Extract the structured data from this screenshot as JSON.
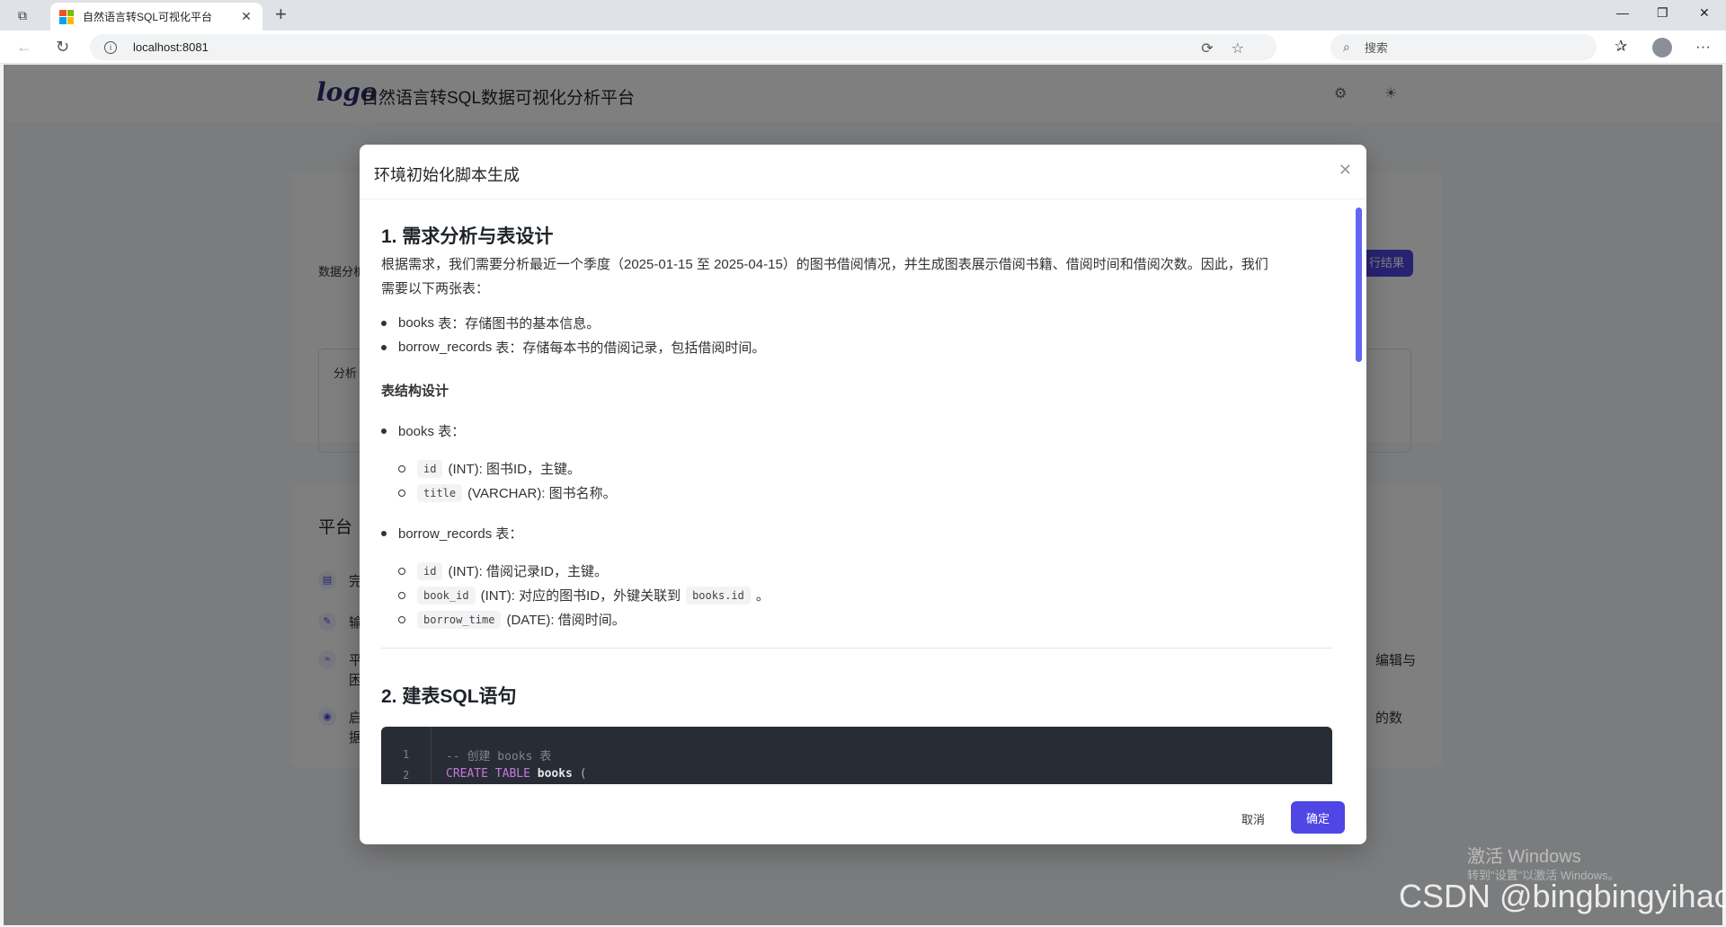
{
  "browser": {
    "tab_title": "自然语言转SQL可视化平台",
    "url": "localhost:8081",
    "search_placeholder": "搜索"
  },
  "app": {
    "logo_text": "logo",
    "title": "自然语言转SQL数据可视化分析平台"
  },
  "background": {
    "analysis_label": "数据分析",
    "result_button": "行结果",
    "area_label": "分析",
    "platform_title": "平台",
    "feature_items": [
      "完",
      "输",
      "平",
      "启"
    ],
    "feature_line2": [
      "困",
      "据"
    ],
    "right_snippets": [
      "编辑与",
      "的数"
    ]
  },
  "modal": {
    "title": "环境初始化脚本生成",
    "section1_title": "1. 需求分析与表设计",
    "intro_line1": "根据需求，我们需要分析最近一个季度（2025-01-15 至 2025-04-15）的图书借阅情况，并生成图表展示借阅书籍、借阅时间和借阅次数。因此，我们",
    "intro_line2": "需要以下两张表：",
    "tables": [
      {
        "name": "books",
        "desc": "表：存储图书的基本信息。"
      },
      {
        "name": "borrow_records",
        "desc": "表：存储每本书的借阅记录，包括借阅时间。"
      }
    ],
    "design_title": "表结构设计",
    "books_label": "books 表：",
    "books_fields": [
      {
        "code": "id",
        "desc": "(INT): 图书ID，主键。"
      },
      {
        "code": "title",
        "desc": "(VARCHAR): 图书名称。"
      }
    ],
    "borrow_label": "borrow_records 表：",
    "borrow_fields": [
      {
        "code": "id",
        "desc": "(INT): 借阅记录ID，主键。"
      },
      {
        "code": "book_id",
        "desc": "(INT): 对应的图书ID，外键关联到",
        "code2": "books.id",
        "tail": "。"
      },
      {
        "code": "borrow_time",
        "desc": "(DATE): 借阅时间。"
      }
    ],
    "section2_title": "2. 建表SQL语句",
    "code_lines": [
      {
        "num": "1",
        "comment": "-- 创建 books 表"
      },
      {
        "num": "2",
        "kw": "CREATE TABLE",
        "ident": "books",
        "rest": " ("
      }
    ],
    "cancel_label": "取消",
    "ok_label": "确定"
  },
  "watermark": {
    "line1": "激活 Windows",
    "line2": "转到\"设置\"以激活 Windows。",
    "csdn": "CSDN @bingbingyihao"
  },
  "colors": {
    "accent": "#4f46e5",
    "code_bg": "#282c34",
    "overlay": "rgba(0,0,0,0.5)"
  }
}
